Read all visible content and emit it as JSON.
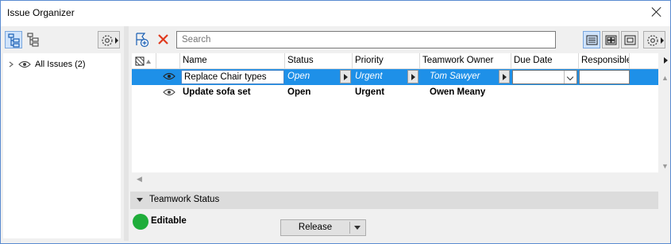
{
  "window": {
    "title": "Issue Organizer"
  },
  "left": {
    "tree": [
      {
        "label": "All Issues (2)"
      }
    ]
  },
  "toolbar": {
    "search_placeholder": "Search"
  },
  "table": {
    "columns": [
      "Name",
      "Status",
      "Priority",
      "Teamwork Owner",
      "Due Date",
      "Responsible"
    ],
    "rows": [
      {
        "name": "Replace Chair types",
        "status": "Open",
        "priority": "Urgent",
        "owner": "Tom Sawyer",
        "due_date": "",
        "responsible": "",
        "selected": true
      },
      {
        "name": "Update sofa set",
        "status": "Open",
        "priority": "Urgent",
        "owner": "Owen Meany",
        "due_date": "",
        "responsible": "",
        "selected": false
      }
    ]
  },
  "teamwork": {
    "title": "Teamwork Status",
    "status": "Editable",
    "status_color": "#1fad3a",
    "release_label": "Release"
  },
  "colors": {
    "selection": "#1e90e8",
    "accent": "#cfe3fb"
  }
}
